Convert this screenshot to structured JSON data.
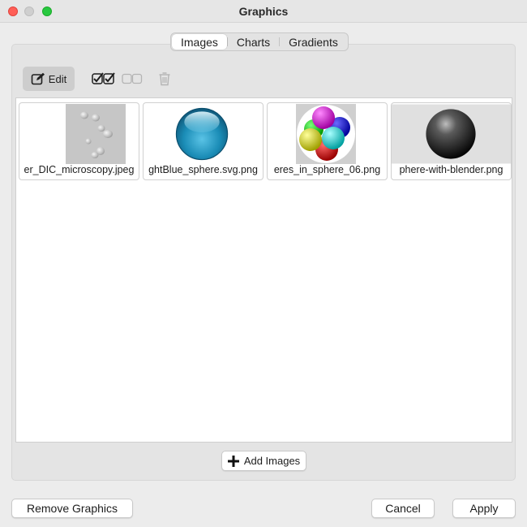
{
  "window": {
    "title": "Graphics"
  },
  "tabs": [
    {
      "label": "Images",
      "selected": true
    },
    {
      "label": "Charts",
      "selected": false
    },
    {
      "label": "Gradients",
      "selected": false
    }
  ],
  "toolbar": {
    "edit_label": "Edit",
    "icons": [
      "edit-icon",
      "select-all-icon",
      "deselect-all-icon",
      "trash-icon"
    ]
  },
  "images": [
    {
      "label": "er_DIC_microscopy.jpeg",
      "icon": "microscopy-thumbnail"
    },
    {
      "label": "ghtBlue_sphere.svg.png",
      "icon": "blue-sphere-thumbnail"
    },
    {
      "label": "eres_in_sphere_06.png",
      "icon": "spheres-in-sphere-thumbnail"
    },
    {
      "label": "phere-with-blender.png",
      "icon": "dark-sphere-thumbnail"
    }
  ],
  "add_images_label": "Add Images",
  "footer": {
    "remove_label": "Remove Graphics",
    "cancel_label": "Cancel",
    "apply_label": "Apply"
  },
  "colors": {
    "close": "#ff5f57",
    "minimize": "#cfcfcf",
    "maximize": "#28c840"
  }
}
